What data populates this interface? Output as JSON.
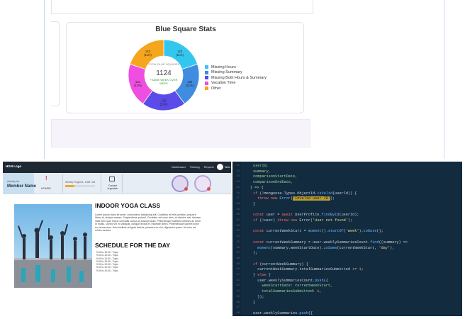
{
  "dashboard": {
    "chart_title": "Blue Square Stats",
    "center_label": "TOTAL BLUE SQUARES",
    "center_value": "1124",
    "center_sub_lines": [
      "+SAME WEEK OVER",
      "WEEK"
    ]
  },
  "chart_data": {
    "type": "pie",
    "title": "Blue Square Stats",
    "categories": [
      "Missing Hours",
      "Missing Summary",
      "Missing Both Hours & Summary",
      "Vacation Time",
      "Other"
    ],
    "colors": [
      "#33c7f0",
      "#3f8ce0",
      "#5b4be8",
      "#ef4fe0",
      "#f6a61c"
    ],
    "values": [
      123,
      123,
      123,
      123,
      123
    ],
    "slice_labels": [
      [
        "123",
        "(11%)"
      ],
      [
        "123",
        "(11%)"
      ],
      [
        "123",
        "(11%)"
      ],
      [
        "123",
        "(11%)"
      ],
      [
        "123",
        "(11%)"
      ]
    ],
    "legend_position": "right"
  },
  "app": {
    "brand": "HGN Logo",
    "nav_links": [
      "Dashboard",
      "Timelog",
      "Reports"
    ],
    "nav_user": "Welc",
    "member_small": "Activity for",
    "member_name": "Member Name",
    "hours_label": "HOURS",
    "progress_label": "Weekly Progress",
    "progress_value": "0.00 / 10",
    "progress_fraction": 0.3,
    "contact_label": "Contact organizer",
    "page_title": "INDOOR YOGA CLASS",
    "paragraph": "Lorem ipsum dolor sit amet, consectetur adipiscing elit. Curabitur et felis porttitor, posuere libero id, tempor massa. Suspendisse potenti. Curabitur vel nunc sem, at ultricies nisi. Aenean vitae sem quis lectus convallis cursus at suscipit dolor. Pellentesque habitant ultricies ac tortor in mollis. Donec vel ex volutpat, congue lectus et, molestie libero. Pellentesque laoreet tortor eu elementum. Duis facilisis at ligula lacinia, pharetra ex nisi, dignissim quam. Ut enim ad minim veniam.",
    "schedule_title": "SCHEDULE FOR THE DAY",
    "schedule": [
      "9:00 to 10:00 - Topic",
      "9:00 to 10:00 - Topic",
      "9:00 to 10:00 - Topic",
      "9:00 to 10:00 - Topic",
      "9:00 to 10:00 - Topic",
      "9:00 to 10:00 - Topic",
      "9:00 to 10:00 - Topic"
    ]
  },
  "code": {
    "lines": [
      {
        "n": "21",
        "t": [
          [
            "userId,",
            "var"
          ]
        ]
      },
      {
        "n": "22",
        "t": [
          [
            "summary,",
            "var"
          ]
        ]
      },
      {
        "n": "23",
        "t": [
          [
            "comparisonStartDate,",
            "var"
          ]
        ]
      },
      {
        "n": "24",
        "t": [
          [
            "comparisonEndDate,",
            "var"
          ]
        ]
      },
      {
        "n": "25",
        "t": [
          [
            "} => {",
            "pn"
          ]
        ],
        "indent": -4
      },
      {
        "n": "26",
        "t": [
          [
            "if",
            "kw"
          ],
          [
            " (!mongoose.Types.ObjectId.",
            "pn"
          ],
          [
            "isValid",
            "fn"
          ],
          [
            "(userId)) {",
            "pn"
          ]
        ]
      },
      {
        "n": "27",
        "t": [
          [
            "  throw new ",
            "kw"
          ],
          [
            "Error",
            "fn"
          ],
          [
            "(",
            "pn"
          ],
          [
            "'Invalid user ID'",
            "hl"
          ],
          [
            ");",
            "pn"
          ]
        ]
      },
      {
        "n": "28",
        "t": [
          [
            "}",
            "pn"
          ]
        ]
      },
      {
        "n": "29",
        "t": [
          [
            "",
            "pn"
          ]
        ]
      },
      {
        "n": "30",
        "t": [
          [
            "const",
            "kw"
          ],
          [
            " user = ",
            "pn"
          ],
          [
            "await",
            "kw"
          ],
          [
            " UserProfile.",
            "pn"
          ],
          [
            "findById",
            "fn"
          ],
          [
            "(userId);",
            "pn"
          ]
        ]
      },
      {
        "n": "31",
        "t": [
          [
            "if",
            "kw"
          ],
          [
            " (!user) ",
            "pn"
          ],
          [
            "throw new",
            "kw"
          ],
          [
            " Error(",
            "pn"
          ],
          [
            "'User not found'",
            "str"
          ],
          [
            ");",
            "pn"
          ]
        ]
      },
      {
        "n": "32",
        "t": [
          [
            "",
            "pn"
          ]
        ]
      },
      {
        "n": "33",
        "t": [
          [
            "const",
            "kw"
          ],
          [
            " currentWeekStart = ",
            "pn"
          ],
          [
            "moment",
            "fn"
          ],
          [
            "().",
            "pn"
          ],
          [
            "startOf",
            "fn"
          ],
          [
            "(",
            "pn"
          ],
          [
            "'week'",
            "str"
          ],
          [
            ").",
            "pn"
          ],
          [
            "toDate",
            "fn"
          ],
          [
            "();",
            "pn"
          ]
        ]
      },
      {
        "n": "34",
        "t": [
          [
            "",
            "pn"
          ]
        ]
      },
      {
        "n": "35",
        "t": [
          [
            "const",
            "kw"
          ],
          [
            " currentWeekSummary = user.weeklySummariesCount.",
            "pn"
          ],
          [
            "find",
            "fn"
          ],
          [
            "((summary) =>",
            "pn"
          ]
        ]
      },
      {
        "n": "36",
        "t": [
          [
            "  moment",
            "fn"
          ],
          [
            "(summary.weekStartDate).",
            "pn"
          ],
          [
            "isSame",
            "fn"
          ],
          [
            "(currentWeekStart, ",
            "pn"
          ],
          [
            "'day'",
            "str"
          ],
          [
            "),",
            "pn"
          ]
        ]
      },
      {
        "n": "37",
        "t": [
          [
            ");",
            "pn"
          ]
        ]
      },
      {
        "n": "38",
        "t": [
          [
            "",
            "pn"
          ]
        ]
      },
      {
        "n": "39",
        "t": [
          [
            "if",
            "kw"
          ],
          [
            " (currentWeekSummary) {",
            "pn"
          ]
        ]
      },
      {
        "n": "40",
        "t": [
          [
            "  currentWeekSummary.totalSummariesSubmitted += ",
            "pn"
          ],
          [
            "1",
            "num"
          ],
          [
            ";",
            "pn"
          ]
        ]
      },
      {
        "n": "41",
        "t": [
          [
            "} ",
            "pn"
          ],
          [
            "else",
            "kw"
          ],
          [
            " {",
            "pn"
          ]
        ]
      },
      {
        "n": "42",
        "t": [
          [
            "  user.weeklySummariesCount.",
            "pn"
          ],
          [
            "push",
            "fn"
          ],
          [
            "({",
            "pn"
          ]
        ]
      },
      {
        "n": "43",
        "t": [
          [
            "    weekStartDate: currentWeekStart,",
            "var"
          ]
        ]
      },
      {
        "n": "44",
        "t": [
          [
            "    totalSummariesSubmitted: ",
            "var"
          ],
          [
            "1",
            "num"
          ],
          [
            ",",
            "pn"
          ]
        ]
      },
      {
        "n": "45",
        "t": [
          [
            "  });",
            "pn"
          ]
        ]
      },
      {
        "n": "46",
        "t": [
          [
            "}",
            "pn"
          ]
        ]
      },
      {
        "n": "47",
        "t": [
          [
            "",
            "pn"
          ]
        ]
      },
      {
        "n": "48",
        "t": [
          [
            "user.weeklySummaries.",
            "pn"
          ],
          [
            "push",
            "fn"
          ],
          [
            "({",
            "pn"
          ]
        ]
      }
    ]
  }
}
